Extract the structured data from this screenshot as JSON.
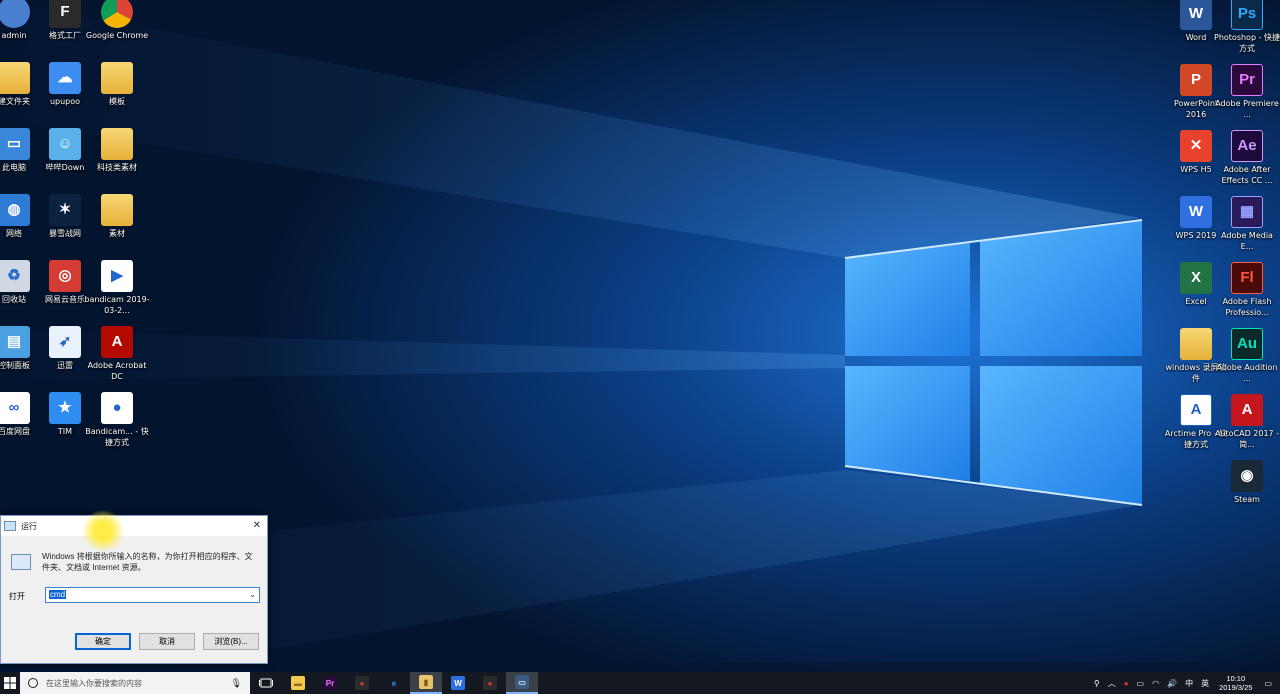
{
  "desktop": {
    "left_icons": [
      {
        "label": "admin",
        "kind": "user",
        "color": "#4a7fcf",
        "glyph": ""
      },
      {
        "label": "格式工厂",
        "kind": "app",
        "color": "#2a2a2a",
        "glyph": "F"
      },
      {
        "label": "Google Chrome",
        "kind": "chrome",
        "color": "#db4437",
        "glyph": ""
      },
      {
        "label": "建文件夹",
        "kind": "folder",
        "color": "#e6b13a",
        "glyph": ""
      },
      {
        "label": "upupoo",
        "kind": "app",
        "color": "#3d8cf0",
        "glyph": "☁"
      },
      {
        "label": "模板",
        "kind": "folder",
        "color": "#e6b13a",
        "glyph": ""
      },
      {
        "label": "此电脑",
        "kind": "pc",
        "color": "#3a86d8",
        "glyph": "▭"
      },
      {
        "label": "哔哔Down",
        "kind": "app",
        "color": "#5ab0e8",
        "glyph": "☺"
      },
      {
        "label": "科技类素材",
        "kind": "folder",
        "color": "#e6b13a",
        "glyph": ""
      },
      {
        "label": "网络",
        "kind": "globe",
        "color": "#2e7bd6",
        "glyph": "◍"
      },
      {
        "label": "暴雪战网",
        "kind": "app",
        "color": "#0c2340",
        "glyph": "✶"
      },
      {
        "label": "素材",
        "kind": "folder",
        "color": "#e6b13a",
        "glyph": ""
      },
      {
        "label": "回收站",
        "kind": "bin",
        "color": "#cfd8e3",
        "glyph": "♻"
      },
      {
        "label": "网易云音乐",
        "kind": "app",
        "color": "#d43c33",
        "glyph": "◎"
      },
      {
        "label": "bandicam 2019-03-2...",
        "kind": "file",
        "color": "#ffffff",
        "glyph": "▶"
      },
      {
        "label": "控制面板",
        "kind": "app",
        "color": "#4aa0e0",
        "glyph": "▤"
      },
      {
        "label": "迅雷",
        "kind": "app",
        "color": "#e9f1fb",
        "glyph": "➶"
      },
      {
        "label": "Adobe Acrobat DC",
        "kind": "app",
        "color": "#b30b00",
        "glyph": "A"
      },
      {
        "label": "百度网盘",
        "kind": "app",
        "color": "#ffffff",
        "glyph": "∞"
      },
      {
        "label": "TIM",
        "kind": "app",
        "color": "#2f8df2",
        "glyph": "★"
      },
      {
        "label": "Bandicam... - 快捷方式",
        "kind": "app",
        "color": "#ffffff",
        "glyph": "●"
      }
    ],
    "right_icons": [
      {
        "label": "Word",
        "color": "#2b579a",
        "glyph": "W"
      },
      {
        "label": "Photoshop - 快捷方式",
        "color": "#0b2a4a",
        "glyph": "Ps",
        "fg": "#31a8ff"
      },
      {
        "label": "PowerPoint 2016",
        "color": "#d24726",
        "glyph": "P"
      },
      {
        "label": "Adobe Premiere ...",
        "color": "#2a0a3a",
        "glyph": "Pr",
        "fg": "#e77bff"
      },
      {
        "label": "WPS H5",
        "color": "#e8412c",
        "glyph": "✕"
      },
      {
        "label": "Adobe After Effects CC ...",
        "color": "#1c0a3a",
        "glyph": "Ae",
        "fg": "#cf96fd"
      },
      {
        "label": "WPS 2019",
        "color": "#2f6fe0",
        "glyph": "W"
      },
      {
        "label": "Adobe Media E...",
        "color": "#2a1a5a",
        "glyph": "▦",
        "fg": "#9aa2ff"
      },
      {
        "label": "Excel",
        "color": "#217346",
        "glyph": "X"
      },
      {
        "label": "Adobe Flash Professio...",
        "color": "#4a0a0a",
        "glyph": "Fl",
        "fg": "#ff5a3c"
      },
      {
        "label": "windows 录屏软件",
        "color": "#e6b13a",
        "glyph": "",
        "folder": true
      },
      {
        "label": "Adobe Audition ...",
        "color": "#0a2a2a",
        "glyph": "Au",
        "fg": "#00e4bb"
      },
      {
        "label": "Arctime Pro - 快捷方式",
        "color": "#ffffff",
        "glyph": "A",
        "fg": "#2060c0"
      },
      {
        "label": "AutoCAD 2017 - 简...",
        "color": "#c4161c",
        "glyph": "A"
      },
      {
        "label": "",
        "color": "#00000000",
        "glyph": ""
      },
      {
        "label": "Steam",
        "color": "#1b2838",
        "glyph": "◉"
      }
    ]
  },
  "run_dialog": {
    "title": "运行",
    "description": "Windows 将根据你所输入的名称，为你打开相应的程序、文件夹、文档或 Internet 资源。",
    "open_label": "打开",
    "input_value": "cmd",
    "ok_label": "确定",
    "cancel_label": "取消",
    "browse_label": "浏览(B)...",
    "close_glyph": "✕",
    "dropdown_glyph": "⌄"
  },
  "taskbar": {
    "search_placeholder": "在这里输入你要搜索的内容",
    "apps": [
      {
        "name": "file-explorer",
        "glyph": "▬",
        "color": "#f2c94c",
        "fg": "#8a6d1e"
      },
      {
        "name": "premiere",
        "glyph": "Pr",
        "color": "#2a0a3a",
        "fg": "#e77bff"
      },
      {
        "name": "record",
        "glyph": "●",
        "color": "#2b2b2b",
        "fg": "#e0312f"
      },
      {
        "name": "edge",
        "glyph": "e",
        "color": "#141921",
        "fg": "#2d8ff0"
      },
      {
        "name": "folder-app",
        "glyph": "▮",
        "color": "#e6c36a",
        "fg": "#7a5a10",
        "active": true
      },
      {
        "name": "wps",
        "glyph": "W",
        "color": "#2f6fe0",
        "fg": "#ffffff"
      },
      {
        "name": "bandicam",
        "glyph": "●",
        "color": "#2b2b2b",
        "fg": "#e0312f"
      },
      {
        "name": "run-window",
        "glyph": "▭",
        "color": "#3a5a80",
        "fg": "#cfe3f7",
        "active": true
      }
    ],
    "tray": {
      "icons": [
        "person-icon",
        "chevron-up-icon",
        "record-icon",
        "display-icon",
        "wifi-icon",
        "volume-icon"
      ],
      "input_method": "中",
      "ime_mode": "英",
      "time": "10:10",
      "date": "2019/3/25",
      "notification_glyph": "▭"
    }
  }
}
